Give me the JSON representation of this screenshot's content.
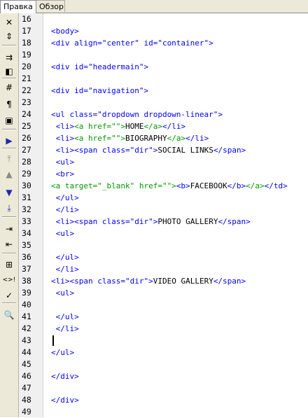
{
  "tabs": [
    {
      "label": "Правка",
      "active": true
    },
    {
      "label": "Обзор",
      "active": false
    }
  ],
  "toolbar": [
    {
      "name": "close-icon",
      "glyph": "✕"
    },
    {
      "name": "split-icon",
      "glyph": "⇕"
    },
    {
      "name": "wrap-icon",
      "glyph": "⇉"
    },
    {
      "name": "insert-tag-icon",
      "glyph": "◧"
    },
    {
      "name": "hash-icon",
      "glyph": "#"
    },
    {
      "name": "paragraph-icon",
      "glyph": "¶"
    },
    {
      "name": "monitor-icon",
      "glyph": "▣"
    },
    {
      "name": "next-icon",
      "glyph": "▶"
    },
    {
      "name": "top-icon",
      "glyph": "⤒"
    },
    {
      "name": "up-icon",
      "glyph": "▲"
    },
    {
      "name": "down-icon",
      "glyph": "▼"
    },
    {
      "name": "bottom-icon",
      "glyph": "⤓"
    },
    {
      "name": "indent-icon",
      "glyph": "⇥"
    },
    {
      "name": "outdent-icon",
      "glyph": "⇤"
    },
    {
      "name": "tree-icon",
      "glyph": "⊞"
    },
    {
      "name": "comment-icon",
      "glyph": "<>!"
    },
    {
      "name": "check-icon",
      "glyph": "✓"
    },
    {
      "name": "search-icon",
      "glyph": "🔍"
    }
  ],
  "lines": [
    {
      "n": "16",
      "text": ""
    },
    {
      "n": "17",
      "text": "<body>"
    },
    {
      "n": "18",
      "text": "<div align=\"center\" id=\"container\">"
    },
    {
      "n": "19",
      "text": ""
    },
    {
      "n": "20",
      "text": "<div id=\"headermain\">"
    },
    {
      "n": "21",
      "text": ""
    },
    {
      "n": "22",
      "text": "<div id=\"navigation\">"
    },
    {
      "n": "23",
      "text": ""
    },
    {
      "n": "24",
      "text": "<ul class=\"dropdown dropdown-linear\">"
    },
    {
      "n": "25",
      "text": " <li><a href=\"\">HOME</a></li>"
    },
    {
      "n": "26",
      "text": " <li><a href=\"\">BIOGRAPHY</a></li>"
    },
    {
      "n": "27",
      "text": " <li><span class=\"dir\">SOCIAL LINKS</span>"
    },
    {
      "n": "28",
      "text": " <ul>"
    },
    {
      "n": "29",
      "text": " <br>"
    },
    {
      "n": "30",
      "text": "<a target=\"_blank\" href=\"\"><b>FACEBOOK</b></a></td>"
    },
    {
      "n": "31",
      "text": " </ul>"
    },
    {
      "n": "32",
      "text": " </li>"
    },
    {
      "n": "33",
      "text": " <li><span class=\"dir\">PHOTO GALLERY</span>"
    },
    {
      "n": "34",
      "text": " <ul>"
    },
    {
      "n": "35",
      "text": ""
    },
    {
      "n": "36",
      "text": " </ul>"
    },
    {
      "n": "37",
      "text": " </li>"
    },
    {
      "n": "38",
      "text": "<li><span class=\"dir\">VIDEO GALLERY</span>"
    },
    {
      "n": "39",
      "text": " <ul>"
    },
    {
      "n": "40",
      "text": ""
    },
    {
      "n": "41",
      "text": " </ul>"
    },
    {
      "n": "42",
      "text": " </li>"
    },
    {
      "n": "43",
      "text": ""
    },
    {
      "n": "44",
      "text": "</ul>"
    },
    {
      "n": "45",
      "text": ""
    },
    {
      "n": "46",
      "text": "</div>"
    },
    {
      "n": "47",
      "text": ""
    },
    {
      "n": "48",
      "text": "</div>"
    },
    {
      "n": "49",
      "text": ""
    }
  ],
  "colors": {
    "tag": "#0000ff",
    "anchor_tag": "#009900",
    "content": "#000000"
  }
}
